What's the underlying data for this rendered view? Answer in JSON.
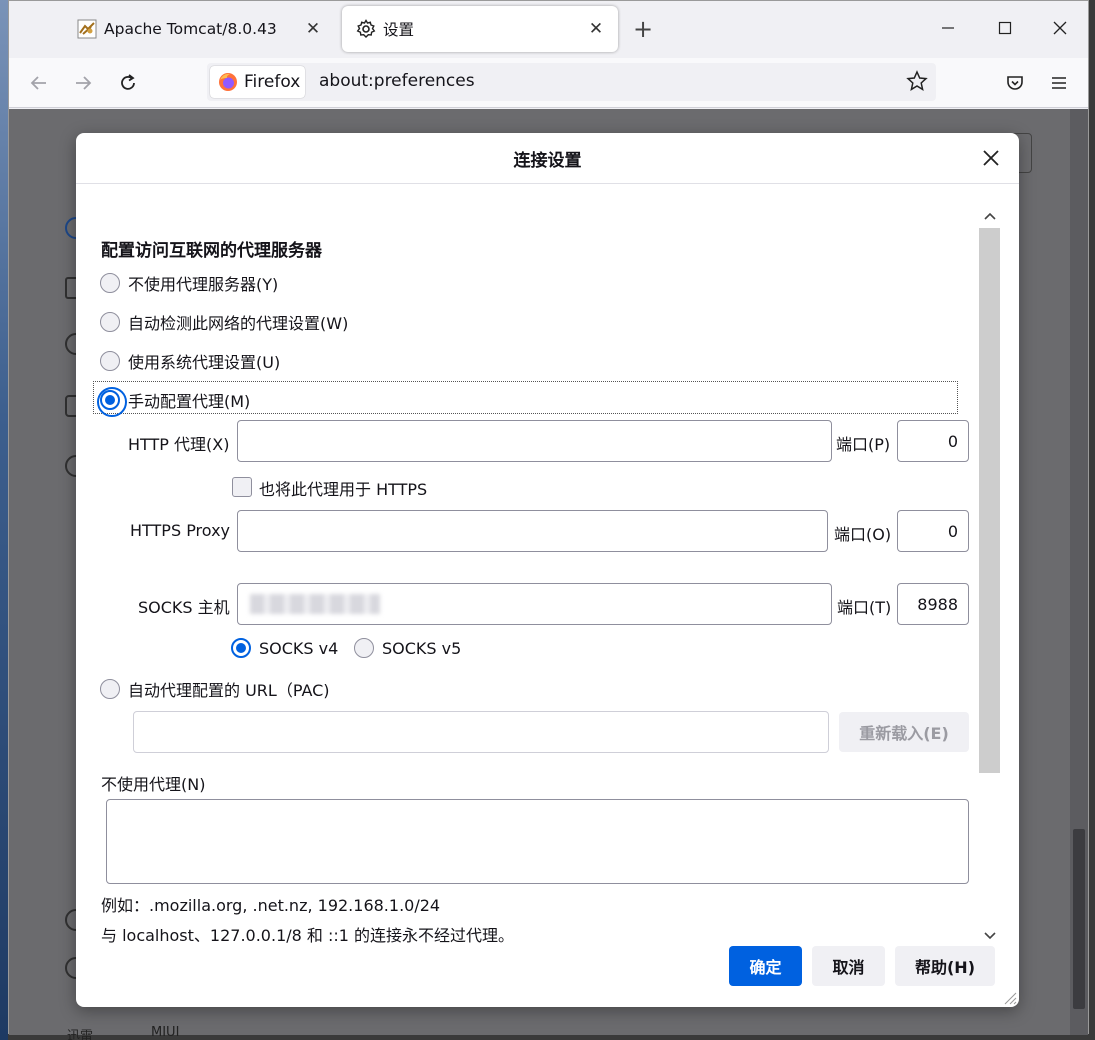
{
  "tabs": [
    {
      "title": "Apache Tomcat/8.0.43",
      "favicon": "tomcat-icon"
    },
    {
      "title": "设置",
      "favicon": "gear-icon"
    }
  ],
  "navbar": {
    "identity_label": "Firefox",
    "url": "about:preferences"
  },
  "background": {
    "bottom_texts": [
      "迅雷",
      "MIUI"
    ]
  },
  "dialog": {
    "title": "连接设置",
    "heading": "配置访问互联网的代理服务器",
    "proxy_options": [
      {
        "label": "不使用代理服务器(Y)",
        "checked": false
      },
      {
        "label": "自动检测此网络的代理设置(W)",
        "checked": false
      },
      {
        "label": "使用系统代理设置(U)",
        "checked": false
      },
      {
        "label": "手动配置代理(M)",
        "checked": true
      }
    ],
    "http": {
      "label": "HTTP 代理(X)",
      "value": "",
      "port_label": "端口(P)",
      "port": "0"
    },
    "also_https": {
      "label": "也将此代理用于 HTTPS",
      "checked": false
    },
    "https": {
      "label": "HTTPS Proxy",
      "value": "",
      "port_label": "端口(O)",
      "port": "0"
    },
    "socks": {
      "label": "SOCKS 主机",
      "value": "",
      "port_label": "端口(T)",
      "port": "8988"
    },
    "socks_versions": [
      {
        "label": "SOCKS v4",
        "checked": true
      },
      {
        "label": "SOCKS v5",
        "checked": false
      }
    ],
    "pac": {
      "label": "自动代理配置的 URL（PAC)",
      "checked": false,
      "value": "",
      "reload_label": "重新载入(E)"
    },
    "no_proxy": {
      "label": "不使用代理(N)",
      "value": ""
    },
    "example": "例如：.mozilla.org, .net.nz, 192.168.1.0/24",
    "localhost_note": "与 localhost、127.0.0.1/8 和 ::1 的连接永不经过代理。",
    "buttons": {
      "ok": "确定",
      "cancel": "取消",
      "help": "帮助(H)"
    }
  },
  "colors": {
    "accent": "#0061e0",
    "overlay": "#6b6b6e"
  }
}
